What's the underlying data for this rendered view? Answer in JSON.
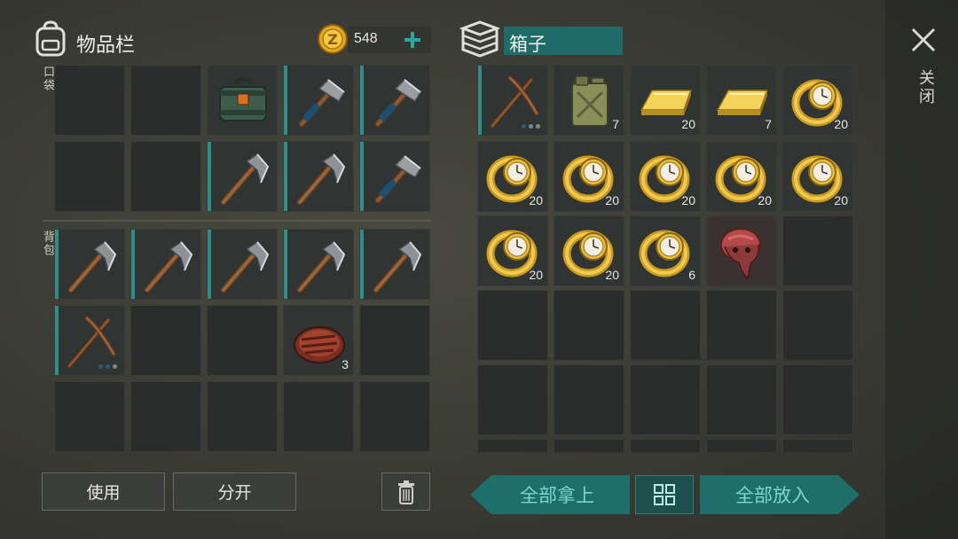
{
  "inventory": {
    "title": "物品栏",
    "currency": "548",
    "sections": {
      "pockets": "口袋",
      "backpack": "背包"
    }
  },
  "container": {
    "title": "箱子"
  },
  "close": {
    "label": "关闭"
  },
  "actions": {
    "use": "使用",
    "split": "分开",
    "take_all": "全部拿上",
    "put_all": "全部放入"
  },
  "colors": {
    "accent": "#2e8f89",
    "gold": "#d8b43a",
    "button_teal": "#1e6e6a"
  },
  "slots": {
    "inv": {
      "r3c3_count": "3"
    },
    "box": {
      "r0c1": "7",
      "r0c2": "20",
      "r0c3": "7",
      "r0c4": "20",
      "r1c0": "20",
      "r1c1": "20",
      "r1c2": "20",
      "r1c3": "20",
      "r1c4": "20",
      "r2c0": "20",
      "r2c1": "20",
      "r2c2": "6"
    }
  }
}
